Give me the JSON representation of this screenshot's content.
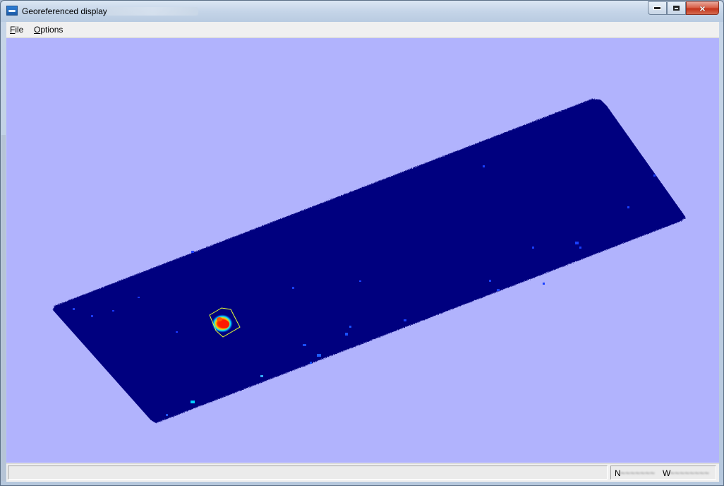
{
  "window": {
    "title": "Georeferenced display",
    "icon": "display-app-icon",
    "controls": {
      "minimize": "minimize-icon",
      "maximize": "maximize-icon",
      "close": "×"
    }
  },
  "menu": {
    "file": {
      "first": "F",
      "rest": "ile"
    },
    "options": {
      "first": "O",
      "rest": "ptions"
    }
  },
  "map": {
    "background_color": "#b1b3fd",
    "field_color": "#00007f",
    "hotspot_colors": [
      "#ff0000",
      "#ffa500",
      "#ffff00",
      "#00ffff",
      "#0060ff"
    ],
    "selection_outline_color": "#e6ff33"
  },
  "status": {
    "left_text": "",
    "coord_n_label": "N",
    "coord_n_value": "~~~~~~~",
    "coord_w_label": "W",
    "coord_w_value": "~~~~~~~~"
  }
}
